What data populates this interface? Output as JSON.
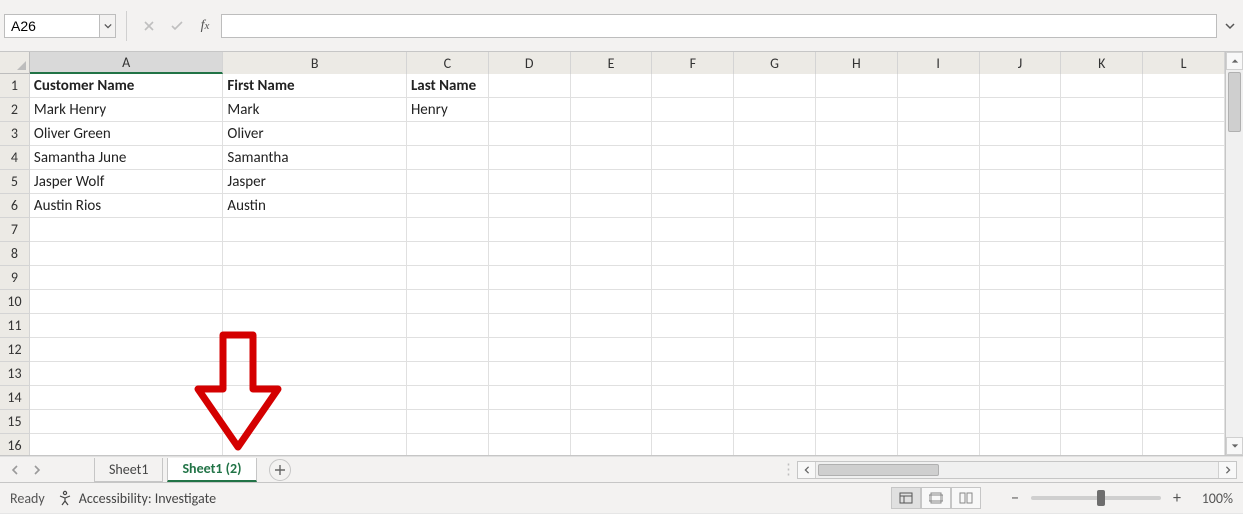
{
  "formula_bar": {
    "name_box": "A26",
    "formula": ""
  },
  "sheet": {
    "visible_columns": [
      "A",
      "B",
      "C",
      "D",
      "E",
      "F",
      "G",
      "H",
      "I",
      "J",
      "K",
      "L"
    ],
    "visible_rows": 16,
    "selected_column": "A",
    "rows": [
      {
        "A": "Customer Name",
        "B": "First Name",
        "C": "Last Name",
        "bold": true
      },
      {
        "A": "Mark Henry",
        "B": "Mark",
        "C": "Henry"
      },
      {
        "A": "Oliver Green",
        "B": "Oliver",
        "C": ""
      },
      {
        "A": "Samantha June",
        "B": "Samantha",
        "C": ""
      },
      {
        "A": "Jasper Wolf",
        "B": "Jasper",
        "C": ""
      },
      {
        "A": "Austin Rios",
        "B": "Austin",
        "C": ""
      }
    ]
  },
  "chart_data": {
    "type": "table",
    "columns": [
      "Customer Name",
      "First Name",
      "Last Name"
    ],
    "rows": [
      [
        "Mark Henry",
        "Mark",
        "Henry"
      ],
      [
        "Oliver Green",
        "Oliver",
        ""
      ],
      [
        "Samantha June",
        "Samantha",
        ""
      ],
      [
        "Jasper Wolf",
        "Jasper",
        ""
      ],
      [
        "Austin Rios",
        "Austin",
        ""
      ]
    ]
  },
  "tabs": {
    "items": [
      {
        "label": "Sheet1",
        "active": false
      },
      {
        "label": "Sheet1 (2)",
        "active": true
      }
    ]
  },
  "status": {
    "mode": "Ready",
    "accessibility": "Accessibility: Investigate",
    "zoom": "100%"
  },
  "annotation": {
    "kind": "down-arrow",
    "color": "#d40000"
  }
}
